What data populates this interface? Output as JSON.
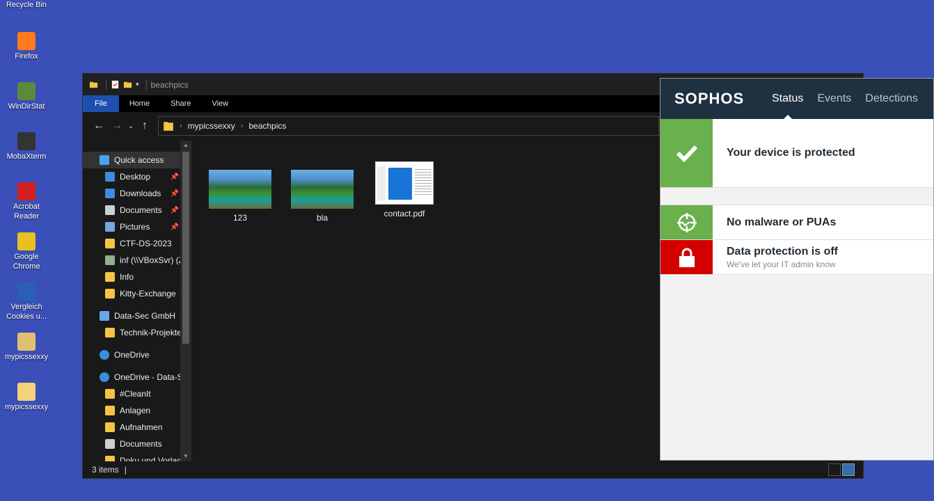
{
  "desktop": {
    "icons": [
      {
        "label": "Recycle Bin",
        "color": "#8ea0b0"
      },
      {
        "label": "Firefox",
        "color": "#ff7a1a"
      },
      {
        "label": "WinDirStat",
        "color": "#5a8a3a"
      },
      {
        "label": "MobaXterm",
        "color": "#333333"
      },
      {
        "label": "Acrobat Reader",
        "color": "#d42020"
      },
      {
        "label": "Google Chrome",
        "color": "#e8c020"
      },
      {
        "label": "Vergleich Cookies u...",
        "color": "#2b5fb5"
      },
      {
        "label": "mypicssexxy",
        "color": "#e0c070"
      },
      {
        "label": "mypicssexxy",
        "color": "#f2d27a"
      }
    ]
  },
  "explorer": {
    "title": "beachpics",
    "ribbon_tabs": [
      "File",
      "Home",
      "Share",
      "View"
    ],
    "breadcrumb": [
      "mypicssexxy",
      "beachpics"
    ],
    "nav_items": [
      {
        "label": "Quick access",
        "indent": 0,
        "icon": "star-icon",
        "selected": true
      },
      {
        "label": "Desktop",
        "indent": 1,
        "icon": "desktop-icon",
        "pinned": true
      },
      {
        "label": "Downloads",
        "indent": 1,
        "icon": "download-icon",
        "pinned": true
      },
      {
        "label": "Documents",
        "indent": 1,
        "icon": "document-icon",
        "pinned": true
      },
      {
        "label": "Pictures",
        "indent": 1,
        "icon": "pictures-icon",
        "pinned": true
      },
      {
        "label": "CTF-DS-2023",
        "indent": 1,
        "icon": "folder-icon"
      },
      {
        "label": "inf (\\\\VBoxSvr) (Z:)",
        "indent": 1,
        "icon": "network-drive-icon"
      },
      {
        "label": "Info",
        "indent": 1,
        "icon": "folder-icon"
      },
      {
        "label": "Kitty-Exchange",
        "indent": 1,
        "icon": "folder-icon"
      },
      {
        "label": "Data-Sec GmbH",
        "indent": 0,
        "icon": "building-icon",
        "gap": true
      },
      {
        "label": "Technik-Projekte",
        "indent": 1,
        "icon": "folder-icon"
      },
      {
        "label": "OneDrive",
        "indent": 0,
        "icon": "cloud-icon",
        "gap": true
      },
      {
        "label": "OneDrive - Data-Sec",
        "indent": 0,
        "icon": "cloud-icon",
        "gap": true
      },
      {
        "label": "#CleanIt",
        "indent": 1,
        "icon": "folder-icon"
      },
      {
        "label": "Anlagen",
        "indent": 1,
        "icon": "folder-icon"
      },
      {
        "label": "Aufnahmen",
        "indent": 1,
        "icon": "folder-icon"
      },
      {
        "label": "Documents",
        "indent": 1,
        "icon": "document-icon"
      },
      {
        "label": "Doku und Vorlagen",
        "indent": 1,
        "icon": "folder-icon"
      }
    ],
    "files": [
      {
        "name": "123",
        "type": "image"
      },
      {
        "name": "bla",
        "type": "image"
      },
      {
        "name": "contact.pdf",
        "type": "pdf"
      }
    ],
    "status": "3 items"
  },
  "sophos": {
    "logo": "SOPHOS",
    "tabs": [
      "Status",
      "Events",
      "Detections"
    ],
    "rows": [
      {
        "title": "Your device is protected",
        "sub": "",
        "color": "#6ab04c",
        "icon": "check-icon"
      },
      {
        "title": "No malware or PUAs",
        "sub": "",
        "color": "#6ab04c",
        "icon": "crosshair-icon"
      },
      {
        "title": "Data protection is off",
        "sub": "We've let your IT admin know",
        "color": "#d40000",
        "icon": "lock-icon"
      }
    ]
  }
}
